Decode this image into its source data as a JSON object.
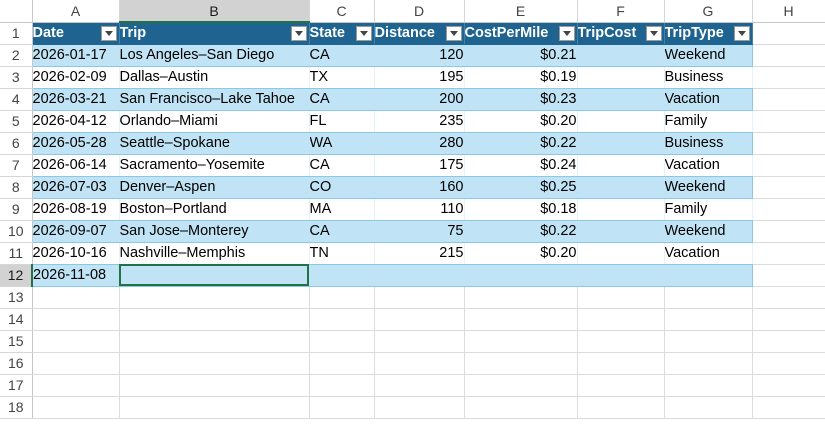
{
  "columns": [
    "A",
    "B",
    "C",
    "D",
    "E",
    "F",
    "G",
    "H"
  ],
  "selected_column": "B",
  "selected_row": "12",
  "table": {
    "headers": [
      {
        "label": "Date"
      },
      {
        "label": "Trip"
      },
      {
        "label": "State"
      },
      {
        "label": "Distance"
      },
      {
        "label": "CostPerMile"
      },
      {
        "label": "TripCost"
      },
      {
        "label": "TripType"
      }
    ],
    "rows": [
      {
        "n": "2",
        "date": "2026-01-17",
        "trip": "Los Angeles–San Diego",
        "state": "CA",
        "distance": "120",
        "cost": "$0.21",
        "tripcost": "",
        "type": "Weekend"
      },
      {
        "n": "3",
        "date": "2026-02-09",
        "trip": "Dallas–Austin",
        "state": "TX",
        "distance": "195",
        "cost": "$0.19",
        "tripcost": "",
        "type": "Business"
      },
      {
        "n": "4",
        "date": "2026-03-21",
        "trip": "San Francisco–Lake Tahoe",
        "state": "CA",
        "distance": "200",
        "cost": "$0.23",
        "tripcost": "",
        "type": "Vacation"
      },
      {
        "n": "5",
        "date": "2026-04-12",
        "trip": "Orlando–Miami",
        "state": "FL",
        "distance": "235",
        "cost": "$0.20",
        "tripcost": "",
        "type": "Family"
      },
      {
        "n": "6",
        "date": "2026-05-28",
        "trip": "Seattle–Spokane",
        "state": "WA",
        "distance": "280",
        "cost": "$0.22",
        "tripcost": "",
        "type": "Business"
      },
      {
        "n": "7",
        "date": "2026-06-14",
        "trip": "Sacramento–Yosemite",
        "state": "CA",
        "distance": "175",
        "cost": "$0.24",
        "tripcost": "",
        "type": "Vacation"
      },
      {
        "n": "8",
        "date": "2026-07-03",
        "trip": "Denver–Aspen",
        "state": "CO",
        "distance": "160",
        "cost": "$0.25",
        "tripcost": "",
        "type": "Weekend"
      },
      {
        "n": "9",
        "date": "2026-08-19",
        "trip": "Boston–Portland",
        "state": "MA",
        "distance": "110",
        "cost": "$0.18",
        "tripcost": "",
        "type": "Family"
      },
      {
        "n": "10",
        "date": "2026-09-07",
        "trip": "San Jose–Monterey",
        "state": "CA",
        "distance": "75",
        "cost": "$0.22",
        "tripcost": "",
        "type": "Weekend"
      },
      {
        "n": "11",
        "date": "2026-10-16",
        "trip": "Nashville–Memphis",
        "state": "TN",
        "distance": "215",
        "cost": "$0.20",
        "tripcost": "",
        "type": "Vacation"
      },
      {
        "n": "12",
        "date": "2026-11-08",
        "trip": "",
        "state": "",
        "distance": "",
        "cost": "",
        "tripcost": "",
        "type": ""
      }
    ]
  },
  "empty_rows": [
    "13",
    "14",
    "15",
    "16",
    "17",
    "18"
  ],
  "colors": {
    "header_fill": "#1f6391",
    "band_fill": "#c0e4f5",
    "selection": "#217346"
  }
}
